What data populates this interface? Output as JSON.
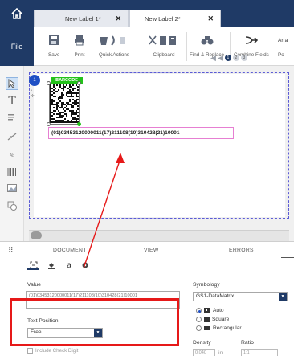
{
  "tabs": [
    {
      "label": "New Label 1*",
      "close": "✕"
    },
    {
      "label": "New Label 2*",
      "close": "✕"
    }
  ],
  "ribbon": {
    "file": "File",
    "buttons": [
      "Save",
      "Print",
      "Quick Actions",
      "Clipboard",
      "Find & Replace",
      "Combine Fields",
      "Arra",
      "Po"
    ]
  },
  "pagestrip": {
    "pages": [
      "1",
      "2",
      "3"
    ]
  },
  "canvas": {
    "badge": "1",
    "barcode_tag": "BARCODE",
    "hri_text": "(01)03453120000011(17)211108(10)310428(21)10001"
  },
  "panel": {
    "tabs": [
      "DOCUMENT",
      "VIEW",
      "ERRORS"
    ],
    "value_label": "Value",
    "value_text": "(01)03453120000011(17)211108(10)310428(21)10001",
    "text_position_label": "Text Position",
    "text_position_value": "Free",
    "include_check_digit": "Include Check Digit",
    "symbology_label": "Symbology",
    "symbology_value": "GS1-DataMatrix",
    "shape_options": [
      "Auto",
      "Square",
      "Rectangular"
    ],
    "density_label": "Density",
    "ratio_label": "Ratio",
    "density_value": "0.040",
    "density_unit": "in",
    "ratio_value": "1:1"
  },
  "colors": {
    "ribbon_dark": "#1f3a66",
    "barcode_tag": "#23c11a",
    "hri_border": "#e67fd2",
    "annotation": "#e61919"
  }
}
